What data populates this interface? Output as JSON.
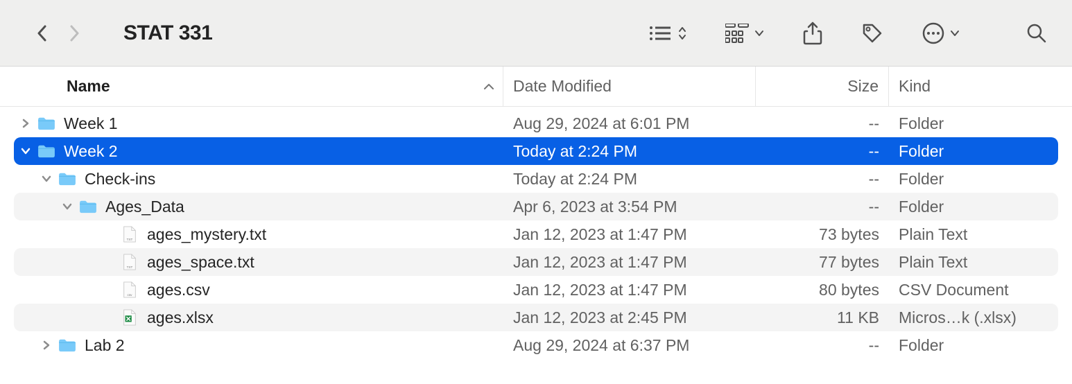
{
  "window": {
    "title": "STAT 331"
  },
  "columns": {
    "name": "Name",
    "date": "Date Modified",
    "size": "Size",
    "kind": "Kind"
  },
  "rows": [
    {
      "name": "Week 1",
      "date": "Aug 29, 2024 at 6:01 PM",
      "size": "--",
      "kind": "Folder",
      "indent": 0,
      "icon": "folder",
      "disclosure": "right",
      "selected": false,
      "alt": false
    },
    {
      "name": "Week 2",
      "date": "Today at 2:24 PM",
      "size": "--",
      "kind": "Folder",
      "indent": 0,
      "icon": "folder",
      "disclosure": "down",
      "selected": true,
      "alt": true
    },
    {
      "name": "Check-ins",
      "date": "Today at 2:24 PM",
      "size": "--",
      "kind": "Folder",
      "indent": 1,
      "icon": "folder",
      "disclosure": "down",
      "selected": false,
      "alt": false
    },
    {
      "name": "Ages_Data",
      "date": "Apr 6, 2023 at 3:54 PM",
      "size": "--",
      "kind": "Folder",
      "indent": 2,
      "icon": "folder",
      "disclosure": "down",
      "selected": false,
      "alt": true
    },
    {
      "name": "ages_mystery.txt",
      "date": "Jan 12, 2023 at 1:47 PM",
      "size": "73 bytes",
      "kind": "Plain Text",
      "indent": 3,
      "icon": "txt",
      "disclosure": "none",
      "selected": false,
      "alt": false
    },
    {
      "name": "ages_space.txt",
      "date": "Jan 12, 2023 at 1:47 PM",
      "size": "77 bytes",
      "kind": "Plain Text",
      "indent": 3,
      "icon": "txt",
      "disclosure": "none",
      "selected": false,
      "alt": true
    },
    {
      "name": "ages.csv",
      "date": "Jan 12, 2023 at 1:47 PM",
      "size": "80 bytes",
      "kind": "CSV Document",
      "indent": 3,
      "icon": "csv",
      "disclosure": "none",
      "selected": false,
      "alt": false
    },
    {
      "name": "ages.xlsx",
      "date": "Jan 12, 2023 at 2:45 PM",
      "size": "11 KB",
      "kind": "Micros…k (.xlsx)",
      "indent": 3,
      "icon": "xlsx",
      "disclosure": "none",
      "selected": false,
      "alt": true
    },
    {
      "name": "Lab 2",
      "date": "Aug 29, 2024 at 6:37 PM",
      "size": "--",
      "kind": "Folder",
      "indent": 1,
      "icon": "folder",
      "disclosure": "right",
      "selected": false,
      "alt": false
    }
  ]
}
